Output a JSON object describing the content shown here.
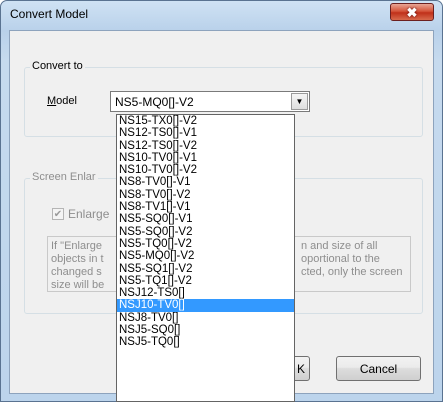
{
  "window": {
    "title": "Convert Model",
    "close_glyph": "✖"
  },
  "convert_group": {
    "label": "Convert to",
    "model_label": "Model",
    "model_value": "NS5-MQ0[]-V2",
    "arrow_glyph": "▼"
  },
  "screen_group": {
    "label": "Screen Enlar",
    "enlarge_label": "Enlarge",
    "enlarge_checked": true,
    "check_glyph": "✔",
    "info_left": [
      "If \"Enlarge",
      "objects in t",
      "changed s",
      "size will be"
    ],
    "info_right": [
      "n and size of all",
      "oportional to the",
      "cted, only the screen",
      ""
    ]
  },
  "buttons": {
    "ok_label": "K",
    "cancel_label": "Cancel"
  },
  "dropdown": {
    "selected_index": 15,
    "items": [
      "NS15-TX0[]-V2",
      "NS12-TS0[]-V1",
      "NS12-TS0[]-V2",
      "NS10-TV0[]-V1",
      "NS10-TV0[]-V2",
      "NS8-TV0[]-V1",
      "NS8-TV0[]-V2",
      "NS8-TV1[]-V1",
      "NS5-SQ0[]-V1",
      "NS5-SQ0[]-V2",
      "NS5-TQ0[]-V2",
      "NS5-MQ0[]-V2",
      "NS5-SQ1[]-V2",
      "NS5-TQ1[]-V2",
      "NSJ12-TS0[]",
      "NSJ10-TV0[]",
      "NSJ8-TV0[]",
      "NSJ5-SQ0[]",
      "NSJ5-TQ0[]"
    ]
  }
}
